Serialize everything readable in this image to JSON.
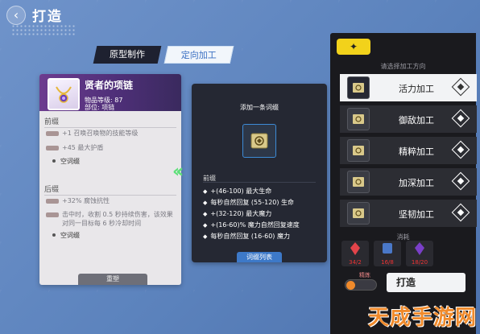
{
  "header": {
    "back_icon": "back-arrow-icon",
    "title": "打造"
  },
  "tabs": [
    {
      "label": "原型制作",
      "active": false
    },
    {
      "label": "定向加工",
      "active": true
    }
  ],
  "item_card": {
    "name": "贤者的项链",
    "level": "物品等级: 87",
    "slot": "部位: 项链",
    "prefix_label": "前缀",
    "prefix_affixes": [
      "+1 召唤召唤物的技能等级",
      "+45 最大护盾"
    ],
    "prefix_empty": "空词缀",
    "suffix_label": "后缀",
    "suffix_affixes": [
      "+32% 腐蚀抗性",
      "击中时，收割 0.5 秒持续伤害，该效果对同一目标每 6 秒冷却时间"
    ],
    "suffix_empty": "空词缀",
    "reshape_button": "重塑"
  },
  "middle_panel": {
    "title": "添加一条词缀",
    "prefix_label": "前缀",
    "items": [
      "+(46-100) 最大生命",
      "每秒自然回复 (55-120) 生命",
      "+(32-120) 最大魔力",
      "+(16-60)% 魔力自然回复速度",
      "每秒自然回复 (16-60) 魔力"
    ],
    "list_button": "词缀列表"
  },
  "right_panel": {
    "badge_icon": "forge-badge-icon",
    "direction_title": "请选择加工方向",
    "options": [
      {
        "label": "活力加工",
        "selected": true
      },
      {
        "label": "御敌加工",
        "selected": false
      },
      {
        "label": "精粹加工",
        "selected": false
      },
      {
        "label": "加深加工",
        "selected": false
      },
      {
        "label": "坚韧加工",
        "selected": false
      }
    ],
    "consume_title": "消耗",
    "materials": [
      {
        "icon": "red-crystal-icon",
        "count": "34/2"
      },
      {
        "icon": "rune-stone-icon",
        "count": "16/8"
      },
      {
        "icon": "purple-crystal-icon",
        "count": "18/20"
      }
    ],
    "refine_label": "精炼",
    "forge_button": "打造"
  },
  "watermark": "天成手游网"
}
